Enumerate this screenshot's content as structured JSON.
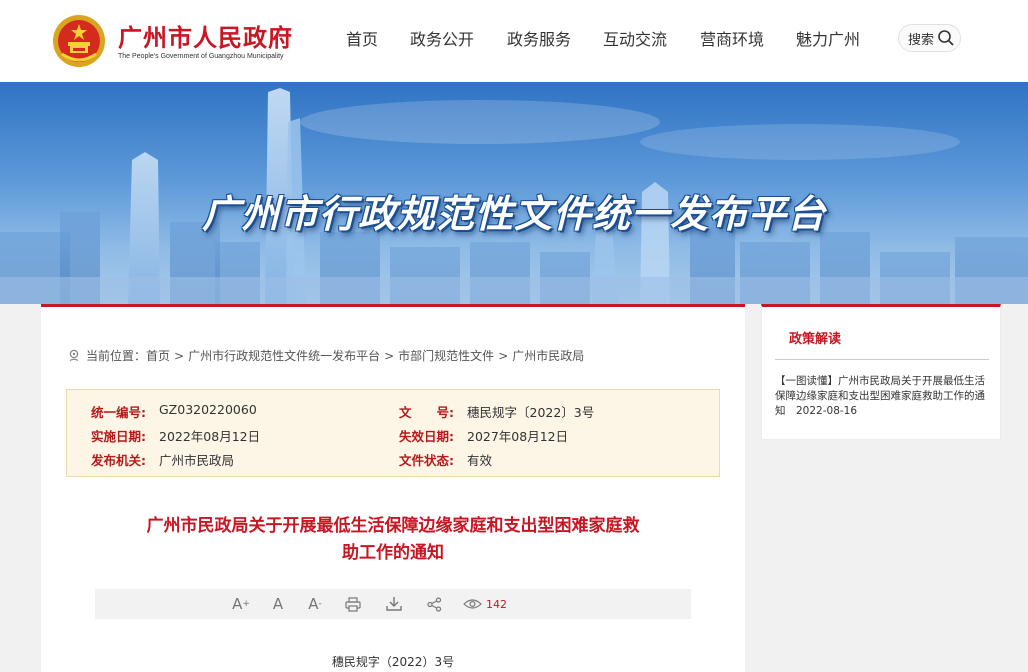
{
  "header": {
    "site_name": "广州市人民政府",
    "site_name_en": "The People's Government of Guangzhou Municipality",
    "nav": [
      {
        "label": "首页"
      },
      {
        "label": "政务公开"
      },
      {
        "label": "政务服务"
      },
      {
        "label": "互动交流"
      },
      {
        "label": "营商环境"
      },
      {
        "label": "魅力广州"
      }
    ],
    "search_label": "搜索"
  },
  "banner": {
    "title": "广州市行政规范性文件统一发布平台"
  },
  "breadcrumb": {
    "prefix": "当前位置：",
    "items": [
      "首页",
      "广州市行政规范性文件统一发布平台",
      "市部门规范性文件",
      "广州市民政局"
    ],
    "separator": ">"
  },
  "meta": {
    "serial_label": "统一编号:",
    "serial_value": "GZ0320220060",
    "docno_label": "文　　号:",
    "docno_value": "穗民规字〔2022〕3号",
    "effective_label": "实施日期:",
    "effective_value": "2022年08月12日",
    "expiry_label": "失效日期:",
    "expiry_value": "2027年08月12日",
    "issuer_label": "发布机关:",
    "issuer_value": "广州市民政局",
    "status_label": "文件状态:",
    "status_value": "有效"
  },
  "document": {
    "title_line1": "广州市民政局关于开展最低生活保障边缘家庭和支出型困难家庭救",
    "title_line2": "助工作的通知",
    "doc_number": "穗民规字（2022）3号"
  },
  "toolbar": {
    "font_increase": "A",
    "font_normal": "A",
    "font_decrease": "A",
    "view_count": "142"
  },
  "sidebar": {
    "title": "政策解读",
    "item_text": "【一图读懂】广州市民政局关于开展最低生活保障边缘家庭和支出型困难家庭救助工作的通知　2022-08-16"
  },
  "colors": {
    "brand_red": "#c81623",
    "meta_bg": "#fdf5e6"
  }
}
